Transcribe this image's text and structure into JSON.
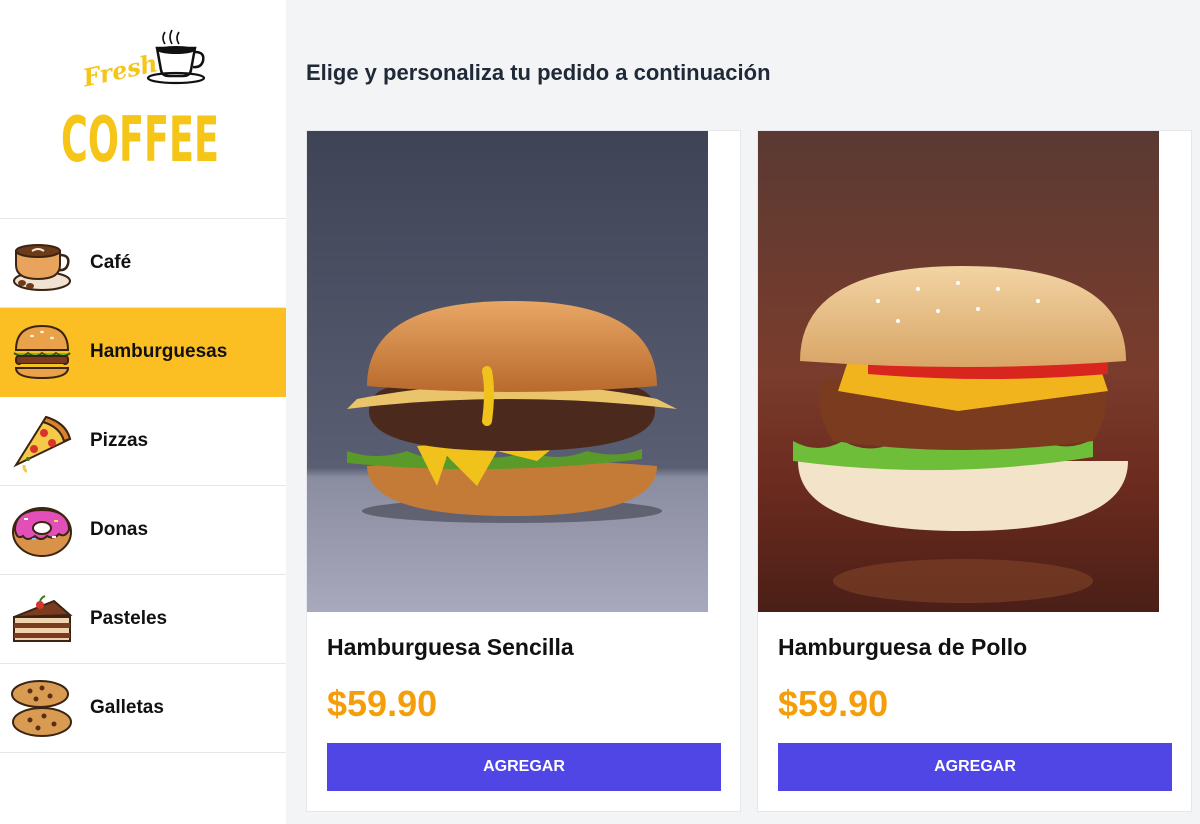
{
  "sidebar": {
    "logo": {
      "word1": "Fresh",
      "word2": "COFFEE",
      "icon": "coffee-cup-icon"
    },
    "categories": [
      {
        "label": "Café",
        "icon": "coffee-cup-icon"
      },
      {
        "label": "Hamburguesas",
        "icon": "burger-icon",
        "active": true
      },
      {
        "label": "Pizzas",
        "icon": "pizza-slice-icon"
      },
      {
        "label": "Donas",
        "icon": "donut-icon"
      },
      {
        "label": "Pasteles",
        "icon": "cake-slice-icon"
      },
      {
        "label": "Galletas",
        "icon": "cookies-icon"
      }
    ]
  },
  "main": {
    "heading": "Elige y personaliza tu pedido a continuación",
    "products": [
      {
        "name": "Hamburguesa Sencilla",
        "price": "$59.90",
        "button": "AGREGAR"
      },
      {
        "name": "Hamburguesa de Pollo",
        "price": "$59.90",
        "button": "AGREGAR"
      }
    ]
  },
  "colors": {
    "accent": "#fbbf24",
    "price": "#f59e0b",
    "button": "#4f46e5"
  }
}
